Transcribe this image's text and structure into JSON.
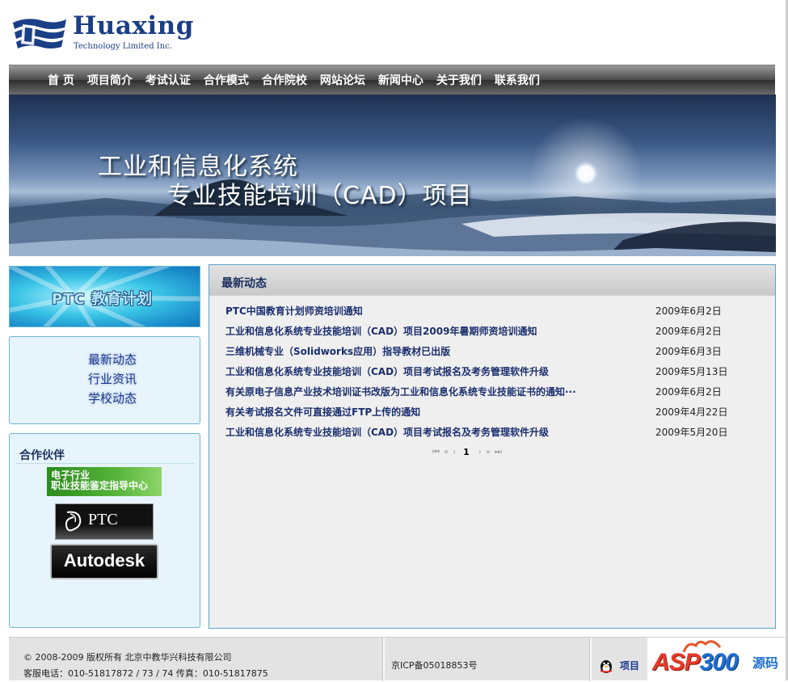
{
  "brand": {
    "name": "Huaxing",
    "subtitle": "Technology Limited Inc."
  },
  "nav": {
    "items": [
      "首 页",
      "项目简介",
      "考试认证",
      "合作模式",
      "合作院校",
      "网站论坛",
      "新闻中心",
      "关于我们",
      "联系我们"
    ]
  },
  "banner": {
    "line1": "工业和信息化系统",
    "line2": "专业技能培训（CAD）项目"
  },
  "sidebar": {
    "ptc_banner": "PTC 教育计划",
    "categories": [
      "最新动态",
      "行业资讯",
      "学校动态"
    ],
    "partners_title": "合作伙伴",
    "partner_logos": {
      "electronics_line1": "电子行业",
      "electronics_line2": "职业技能鉴定指导中心",
      "ptc": "PTC",
      "autodesk": "Autodesk"
    }
  },
  "news": {
    "title": "最新动态",
    "items": [
      {
        "title": "PTC中国教育计划师资培训通知",
        "date": "2009年6月2日"
      },
      {
        "title": "工业和信息化系统专业技能培训（CAD）项目2009年暑期师资培训通知",
        "date": "2009年6月2日"
      },
      {
        "title": "三维机械专业（Solidworks应用）指导教材已出版",
        "date": "2009年6月3日"
      },
      {
        "title": "工业和信息化系统专业技能培训（CAD）项目考试报名及考务管理软件升级",
        "date": "2009年5月13日"
      },
      {
        "title": "有关原电子信息产业技术培训证书改版为工业和信息化系统专业技能证书的通知···",
        "date": "2009年6月2日"
      },
      {
        "title": "有关考试报名文件可直接通过FTP上传的通知",
        "date": "2009年4月22日"
      },
      {
        "title": "工业和信息化系统专业技能培训（CAD）项目考试报名及考务管理软件升级",
        "date": "2009年5月20日"
      }
    ],
    "pager": {
      "first": "⏮",
      "prev10": "«",
      "prev": "‹",
      "current": "1",
      "next": "›",
      "next10": "»",
      "last": "⏭"
    }
  },
  "footer": {
    "copyright": "© 2008-2009 版权所有   北京中教华兴科技有限公司",
    "contact": "客服电话：010-51817872 / 73 / 74   传真：010-51817875",
    "icp": "京ICP备05018853号",
    "qq_label": "项目",
    "watermark_asp": "ASP",
    "watermark_num": "300",
    "watermark_cn": "源码"
  },
  "colors": {
    "nav_text": "#ffffff",
    "link_blue": "#1a2e6e",
    "panel_border": "#5aa3c9"
  }
}
